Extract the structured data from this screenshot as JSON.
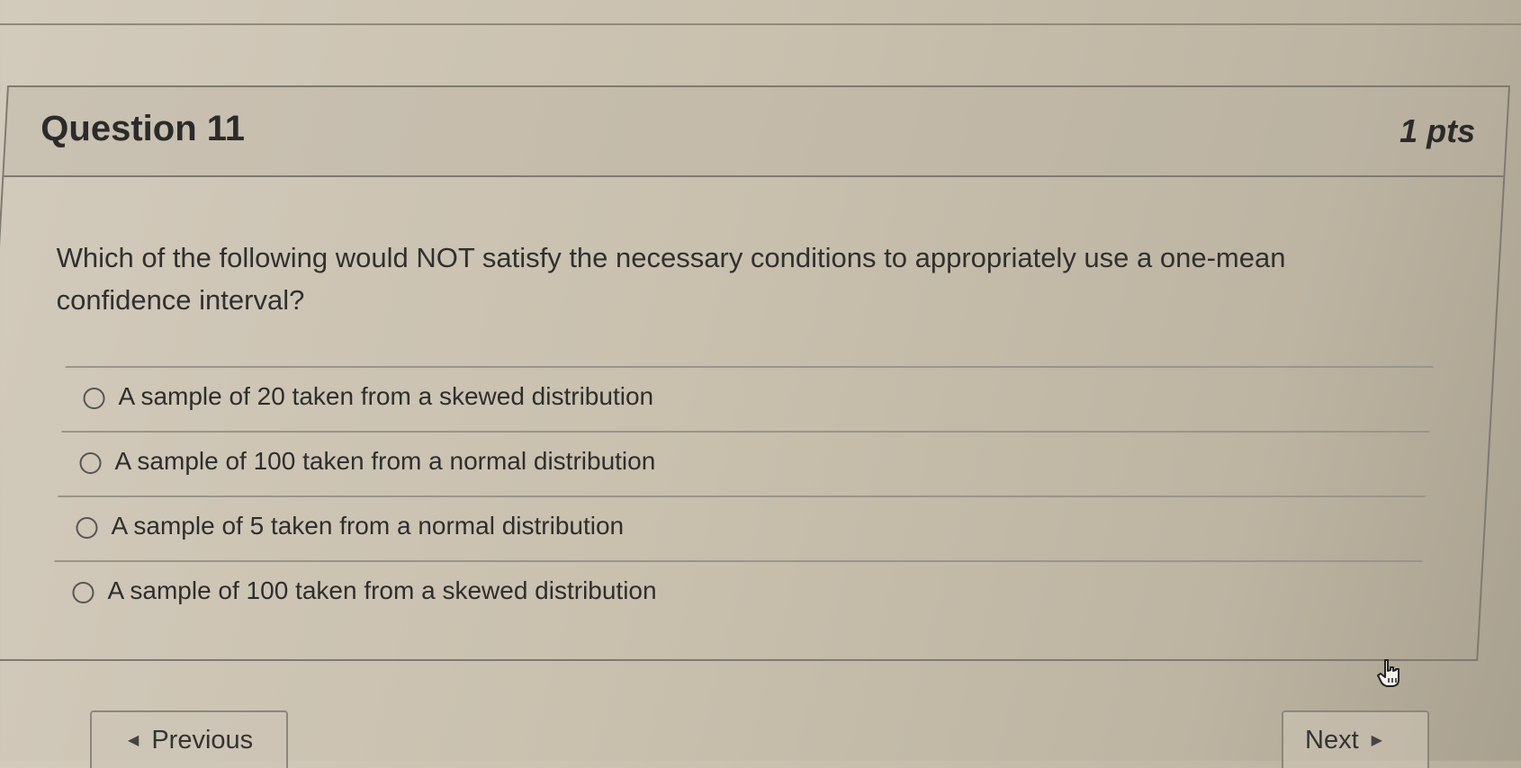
{
  "question": {
    "title": "Question 11",
    "points": "1 pts",
    "text": "Which of the following would NOT satisfy the necessary conditions to appropriately use a one-mean confidence interval?"
  },
  "answers": [
    {
      "label": "A sample of 20 taken from a skewed distribution",
      "selected": false
    },
    {
      "label": "A sample of 100 taken from a normal distribution",
      "selected": false
    },
    {
      "label": "A sample of 5 taken from a normal distribution",
      "selected": false
    },
    {
      "label": "A sample of 100 taken from a skewed distribution",
      "selected": false
    }
  ],
  "navigation": {
    "previous_label": "Previous",
    "next_label": "Next",
    "previous_icon": "caret-left-icon",
    "next_icon": "caret-right-icon"
  },
  "pointer_icon": "hand-pointer-icon"
}
